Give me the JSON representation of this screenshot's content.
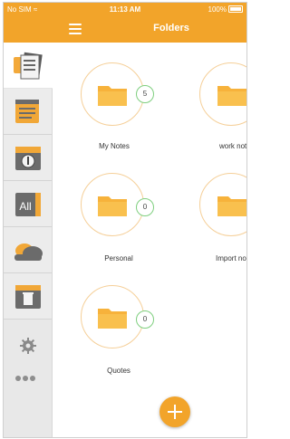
{
  "status_bar": {
    "carrier": "No SIM",
    "time": "11:13 AM",
    "battery": "100%"
  },
  "nav": {
    "title": "Folders"
  },
  "sidebar": {
    "items": [
      {
        "icon": "notes-icon"
      },
      {
        "icon": "notepad-icon"
      },
      {
        "icon": "calendar-icon"
      },
      {
        "icon": "all-icon",
        "label": "All"
      },
      {
        "icon": "cloud-icon"
      },
      {
        "icon": "trash-icon"
      }
    ],
    "settings_icon": "gear-icon",
    "more_icon": "more-dots-icon"
  },
  "folders": [
    {
      "name": "My Notes",
      "count": "5"
    },
    {
      "name": "work note",
      "count": ""
    },
    {
      "name": "Personal",
      "count": "0"
    },
    {
      "name": "Import not",
      "count": ""
    },
    {
      "name": "Quotes",
      "count": "0"
    }
  ],
  "colors": {
    "accent": "#f2a42a",
    "folder": "#f7b23b",
    "badge_border": "#7fcf7f"
  }
}
